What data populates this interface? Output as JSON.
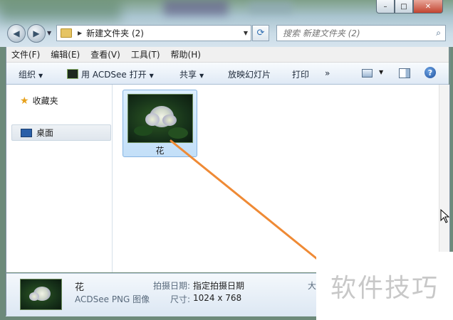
{
  "window": {
    "caption_buttons": [
      "–",
      "□",
      "✕"
    ]
  },
  "nav": {
    "address_path": "新建文件夹 (2)",
    "search_placeholder": "搜索 新建文件夹 (2)"
  },
  "menu": [
    "文件(F)",
    "编辑(E)",
    "查看(V)",
    "工具(T)",
    "帮助(H)"
  ],
  "toolbar": {
    "organize": "组织",
    "open_with": "用 ACDSee 打开",
    "share": "共享",
    "slideshow": "放映幻灯片",
    "print": "打印",
    "more": "»"
  },
  "sidebar": {
    "favorites": "收藏夹",
    "desktop": "桌面"
  },
  "files": [
    {
      "name": "花"
    }
  ],
  "details": {
    "name": "花",
    "type": "ACDSee PNG 图像",
    "date_taken_label": "拍摄日期:",
    "date_taken_value": "指定拍摄日期",
    "dimensions_label": "尺寸:",
    "dimensions_value": "1024 x 768",
    "size_label_partial": "大"
  },
  "watermark": "软件技巧",
  "colors": {
    "annotation": "#ef8a35",
    "selection": "#c9e2f8"
  }
}
